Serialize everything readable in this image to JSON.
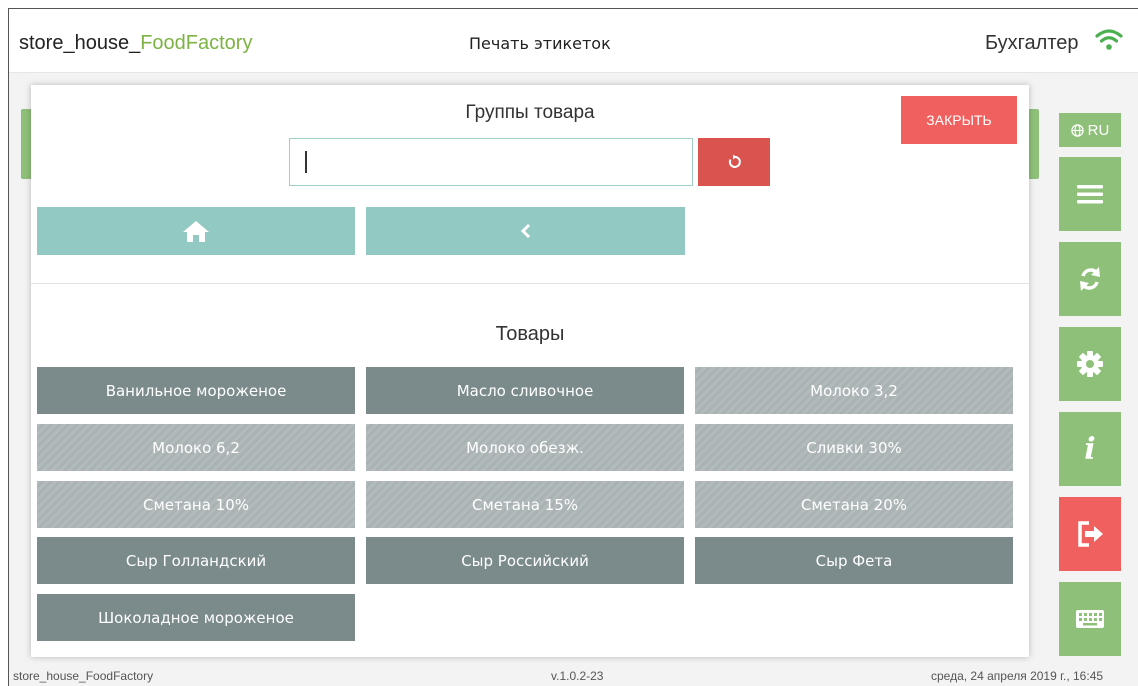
{
  "header": {
    "app_name_prefix": "store_house_",
    "app_name_accent": "FoodFactory",
    "screen_title": "Печать этикеток",
    "user_name": "Бухгалтер"
  },
  "side": {
    "language": "RU"
  },
  "modal": {
    "title": "Группы товара",
    "close_label": "ЗАКРЫТЬ",
    "search_value": "",
    "products_title": "Товары",
    "products": [
      {
        "label": "Ванильное мороженое",
        "style": "dark"
      },
      {
        "label": "Масло сливочное",
        "style": "dark"
      },
      {
        "label": "Молоко 3,2",
        "style": "light"
      },
      {
        "label": "Молоко 6,2",
        "style": "light"
      },
      {
        "label": "Молоко обезж.",
        "style": "light"
      },
      {
        "label": "Сливки 30%",
        "style": "light"
      },
      {
        "label": "Сметана 10%",
        "style": "light"
      },
      {
        "label": "Сметана 15%",
        "style": "light"
      },
      {
        "label": "Сметана 20%",
        "style": "light"
      },
      {
        "label": "Сыр Голландский",
        "style": "dark"
      },
      {
        "label": "Сыр Российский",
        "style": "dark"
      },
      {
        "label": "Сыр Фета",
        "style": "dark"
      },
      {
        "label": "Шоколадное мороженое",
        "style": "dark"
      }
    ]
  },
  "footer": {
    "app": "store_house_FoodFactory",
    "version": "v.1.0.2-23",
    "datetime": "среда, 24 апреля 2019 г., 16:45"
  },
  "colors": {
    "green": "#8fc079",
    "red": "#f0605e",
    "teal": "#93c9c3",
    "dark_product": "#7b8a8b",
    "light_product": "#b2babb"
  }
}
